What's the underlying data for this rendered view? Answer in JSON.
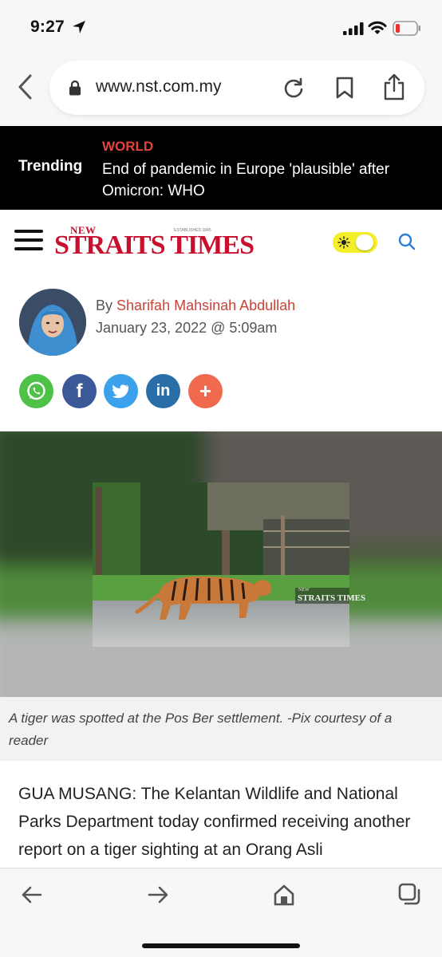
{
  "status_bar": {
    "time": "9:27"
  },
  "browser": {
    "url": "www.nst.com.my"
  },
  "trending": {
    "label": "Trending",
    "category": "WORLD",
    "headline": "End of pandemic in Europe 'plausible' after Omicron: WHO"
  },
  "header": {
    "logo_new": "NEW",
    "logo_est": "ESTABLISHED 1845",
    "logo_main": "STRAITS TIMES"
  },
  "author": {
    "by": "By",
    "name": "Sharifah Mahsinah Abdullah",
    "date": "January 23, 2022 @ 5:09am"
  },
  "share": [
    {
      "name": "whatsapp",
      "glyph": "✆",
      "color": "#4dc247"
    },
    {
      "name": "facebook",
      "glyph": "f",
      "color": "#3b5998"
    },
    {
      "name": "twitter",
      "glyph": "🐦",
      "color": "#3ca1ec"
    },
    {
      "name": "linkedin",
      "glyph": "in",
      "color": "#2a6ea8"
    },
    {
      "name": "more",
      "glyph": "+",
      "color": "#ef6a4e"
    }
  ],
  "image": {
    "watermark": "STRAITS TIMES",
    "watermark_small": "NEW"
  },
  "caption": "A tiger was spotted at the Pos Ber settlement. -Pix courtesy of a reader",
  "article": {
    "text": "GUA MUSANG: The Kelantan Wildlife and National Parks Department today confirmed receiving another report on a tiger sighting at an Orang Asli"
  },
  "colors": {
    "accent": "#c8102e",
    "trending_bg": "#000000",
    "category": "#e0443c"
  }
}
